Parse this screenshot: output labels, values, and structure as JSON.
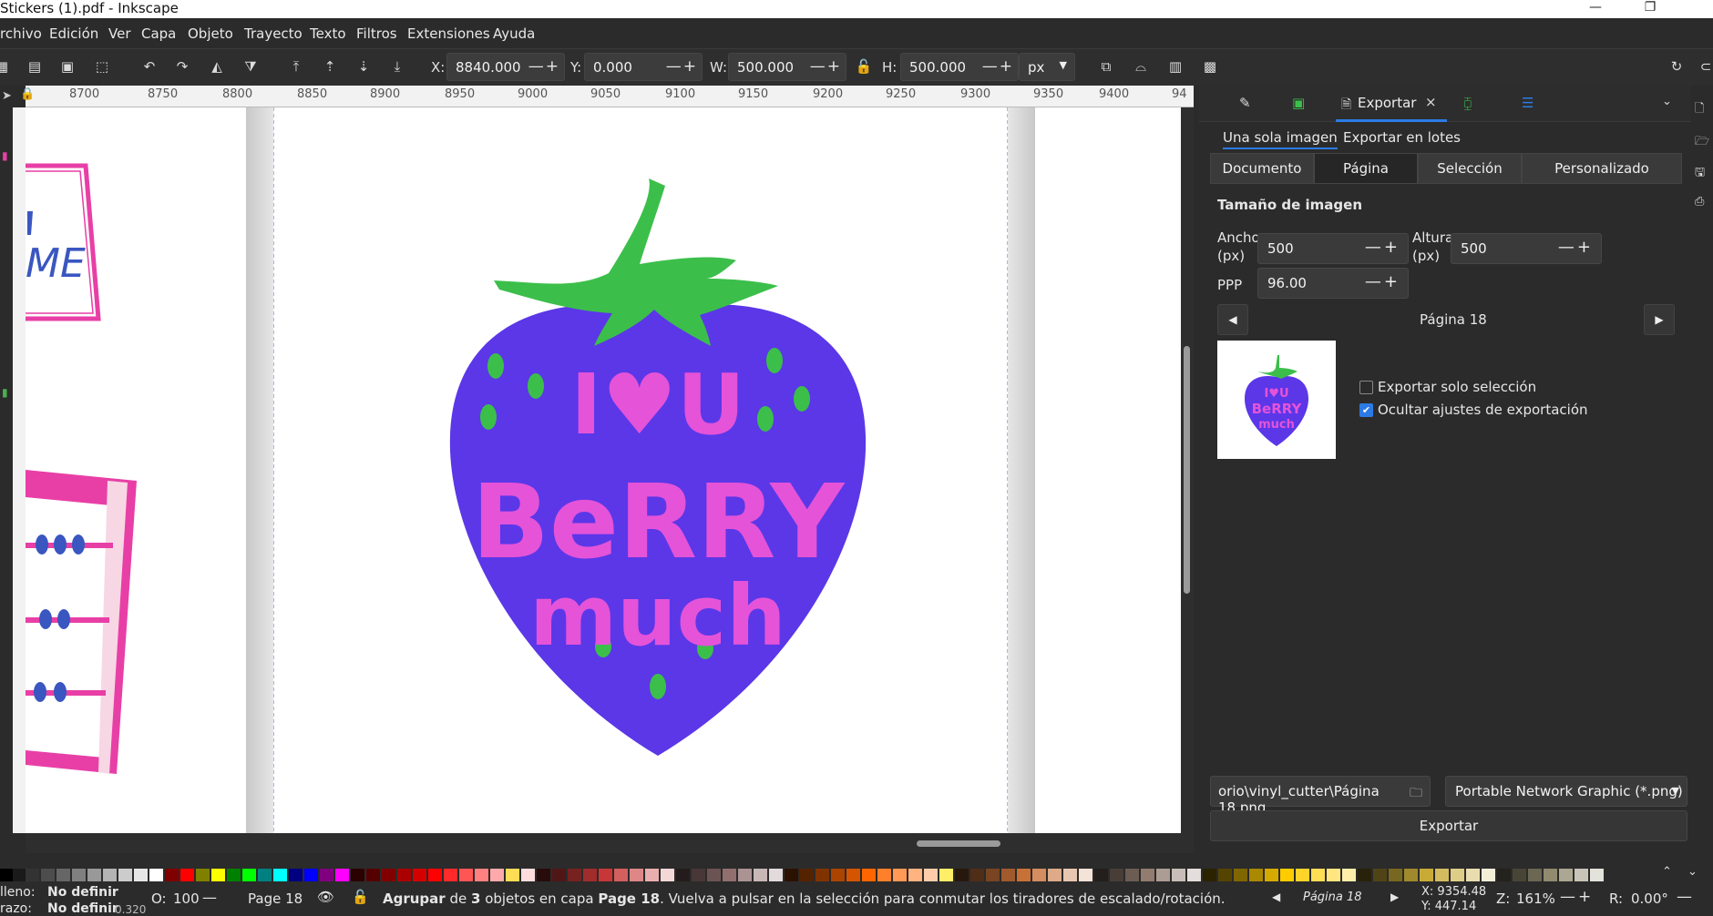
{
  "window": {
    "title": "Stickers (1).pdf - Inkscape"
  },
  "menu": [
    "rchivo",
    "Edición",
    "Ver",
    "Capa",
    "Objeto",
    "Trayecto",
    "Texto",
    "Filtros",
    "Extensiones",
    "Ayuda"
  ],
  "toolbar": {
    "x_label": "X:",
    "x_value": "8840.000",
    "y_label": "Y:",
    "y_value": "0.000",
    "w_label": "W:",
    "w_value": "500.000",
    "h_label": "H:",
    "h_value": "500.000",
    "unit": "px"
  },
  "ruler": {
    "ticks": [
      "8700",
      "8750",
      "8800",
      "8850",
      "8900",
      "8950",
      "9000",
      "9050",
      "9100",
      "9150",
      "9200",
      "9250",
      "9300",
      "9350",
      "9400",
      "94"
    ]
  },
  "canvas": {
    "sticker_line1": "I♥U",
    "sticker_line2": "BeRRY",
    "sticker_line3": "much",
    "left_partial_text": "ME",
    "colors": {
      "berry": "#5b37e8",
      "leaves": "#3bbf4a",
      "text": "#e553d8",
      "frame": "#e83fa6"
    }
  },
  "export_panel": {
    "tab_title": "Exportar",
    "mode_tabs": [
      "Una sola imagen",
      "Exportar en lotes"
    ],
    "area_buttons": [
      "Documento",
      "Página",
      "Selección",
      "Personalizado"
    ],
    "active_area": "Página",
    "section_title": "Tamaño de imagen",
    "width_label_1": "Ancho",
    "width_label_2": "(px)",
    "width_value": "500",
    "height_label_1": "Altura",
    "height_label_2": "(px)",
    "height_value": "500",
    "dpi_label": "PPP",
    "dpi_value": "96.00",
    "page_label": "Página 18",
    "opt_selection_only": "Exportar solo selección",
    "opt_hide_settings": "Ocultar ajustes de exportación",
    "path_value": "orio\\vinyl_cutter\\Página 18.png",
    "format_value": "Portable Network Graphic (*.png)",
    "export_button": "Exportar"
  },
  "status": {
    "fill_label": "lleno:",
    "fill_value": "No definir",
    "stroke_label": "razo:",
    "stroke_value": "No definir",
    "stroke_width": "0.320",
    "opacity_label": "O:",
    "opacity_value": "100",
    "page_indicator": "Page 18",
    "message_bold1": "Agrupar",
    "message_mid1": " de ",
    "message_bold2": "3",
    "message_mid2": " objetos en capa ",
    "message_bold3": "Page 18",
    "message_rest": ". Vuelva a pulsar en la selección para conmutar los tiradores de escalado/rotación.",
    "page_select": "Página 18",
    "coord_x": "X:  9354.48",
    "coord_y": "Y:    447.14",
    "zoom_label": "Z:",
    "zoom_value": "161%",
    "rot_label": "R:",
    "rot_value": "0.00°"
  }
}
